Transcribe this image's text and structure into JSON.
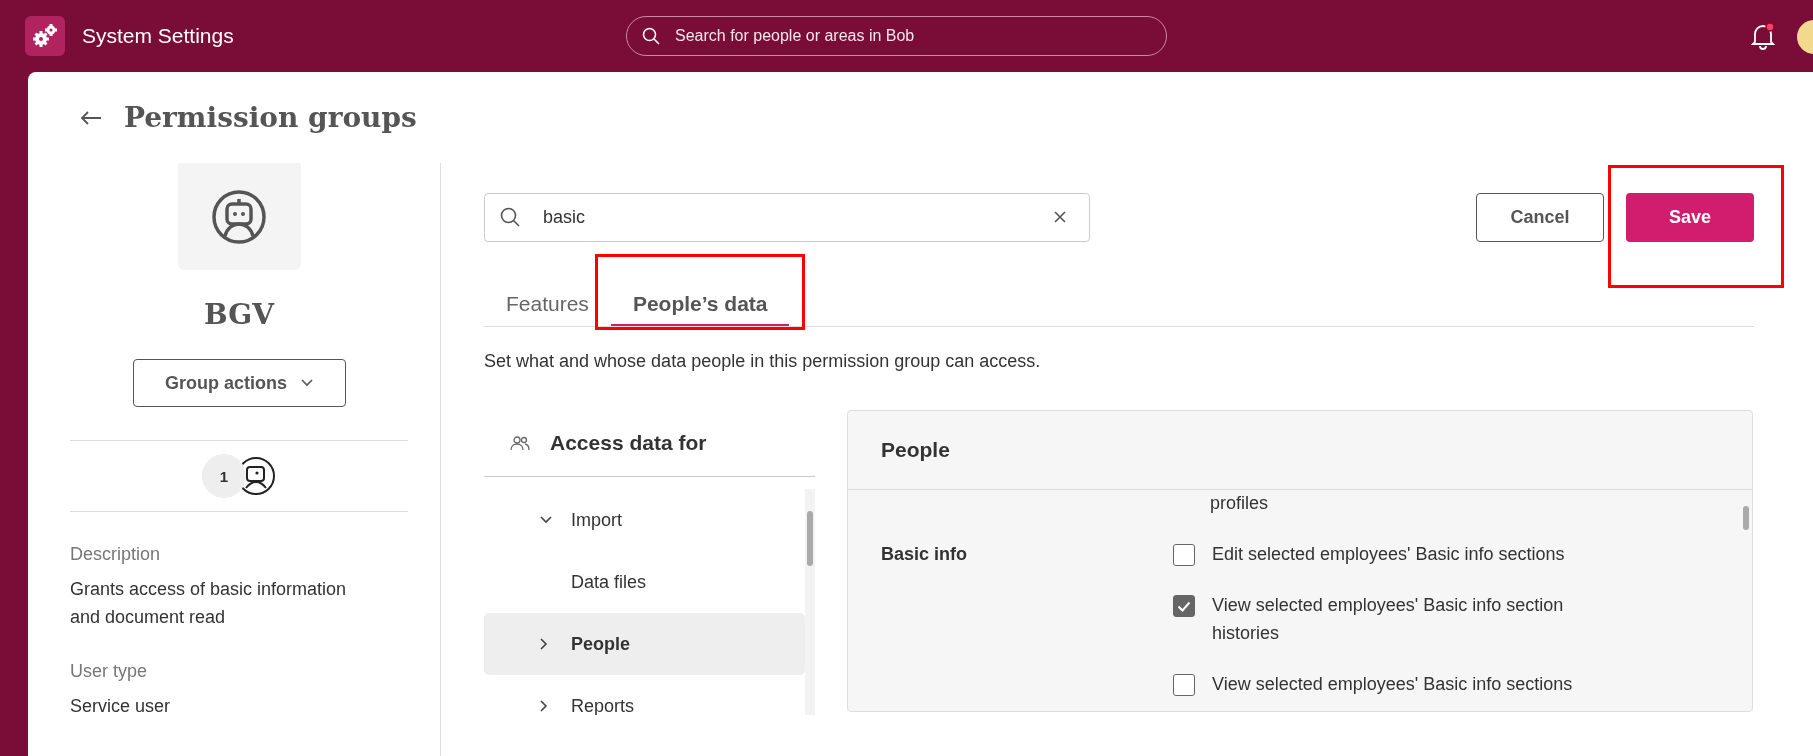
{
  "top_bar": {
    "title": "System Settings",
    "search": {
      "placeholder": "Search for people or areas in Bob"
    },
    "notifications": {
      "unread": true
    }
  },
  "page": {
    "title": "Permission groups"
  },
  "group": {
    "name": "BGV",
    "actions_button": "Group actions",
    "member_count": "1",
    "details": [
      {
        "label": "Description",
        "value": "Grants access of basic information and document read"
      },
      {
        "label": "User type",
        "value": "Service user"
      }
    ]
  },
  "toolbar": {
    "search": {
      "value": "basic"
    },
    "buttons": [
      {
        "label": "Cancel",
        "kind": "secondary",
        "annotated": false
      },
      {
        "label": "Save",
        "kind": "primary",
        "annotated": true
      }
    ]
  },
  "tabs": [
    {
      "label": "Features",
      "selected": false,
      "annotated": false
    },
    {
      "label": "People’s data",
      "selected": true,
      "annotated": true
    }
  ],
  "intro": "Set what and whose data people in this permission group can access.",
  "access": {
    "title": "Access data for",
    "items": [
      {
        "label": "Import",
        "expanded": true,
        "selected": false,
        "children": [
          {
            "label": "Data files",
            "selected": false
          }
        ]
      },
      {
        "label": "People",
        "expanded": false,
        "selected": true
      },
      {
        "label": "Reports",
        "expanded": false,
        "selected": false
      }
    ]
  },
  "permissions": {
    "title": "People",
    "partial_text": "profiles",
    "sections": [
      {
        "label": "Basic info",
        "options": [
          {
            "label": "Edit selected employees' Basic info sections",
            "checked": false
          },
          {
            "label": "View selected employees' Basic info section histories",
            "checked": true
          },
          {
            "label": "View selected employees' Basic info sections",
            "checked": false
          }
        ]
      }
    ]
  }
}
